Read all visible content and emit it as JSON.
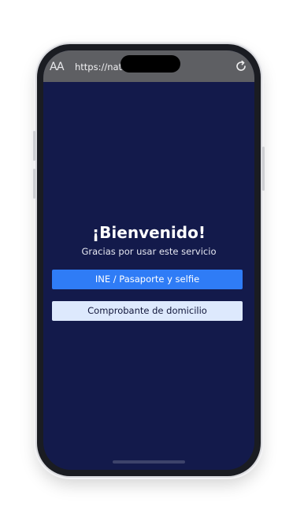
{
  "browser": {
    "text_size_label": "AA",
    "url": "https://nat…s.com.mx",
    "reload_icon": "reload-icon"
  },
  "welcome": {
    "title": "¡Bienvenido!",
    "subtitle": "Gracias por usar este servicio"
  },
  "actions": {
    "primary_label": "INE / Pasaporte y selfie",
    "secondary_label": "Comprobante de domicilio"
  },
  "colors": {
    "background": "#131a4b",
    "primary_button": "#2f7cf6",
    "secondary_button": "#dde9fd"
  }
}
